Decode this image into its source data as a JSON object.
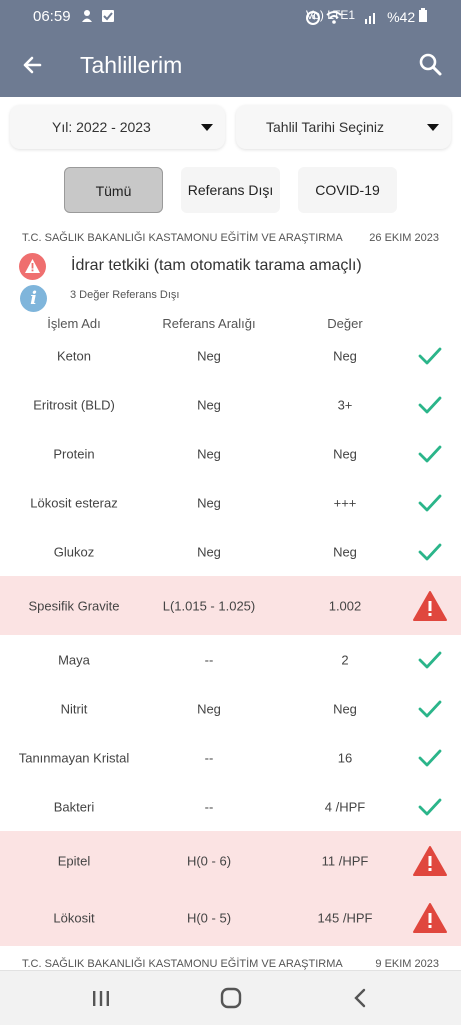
{
  "status_bar": {
    "time": "06:59",
    "network": "Vo) LTE1",
    "battery": "%42"
  },
  "app_bar": {
    "title": "Tahlillerim",
    "back_icon": "arrow-left-icon",
    "search_icon": "search-icon"
  },
  "filters": {
    "year": "Yıl: 2022 - 2023",
    "date": "Tahlil Tarihi Seçiniz"
  },
  "tabs": [
    {
      "label": "Tümü",
      "active": true
    },
    {
      "label": "Referans Dışı",
      "active": false
    },
    {
      "label": "COVID-19",
      "active": false
    }
  ],
  "record": {
    "institution": "T.C. SAĞLIK BAKANLIĞI KASTAMONU EĞİTİM VE ARAŞTIRMA",
    "date": "26 EKIM 2023",
    "test_name": "İdrar tetkiki (tam otomatik tarama amaçlı)",
    "out_of_range_text": "3 Değer Referans Dışı",
    "info_icon_letter": "i"
  },
  "table": {
    "headers": [
      "İşlem Adı",
      "Referans Aralığı",
      "Değer"
    ],
    "rows": [
      {
        "name": "Keton",
        "ref": "Neg",
        "value": "Neg",
        "status": "ok"
      },
      {
        "name": "Eritrosit (BLD)",
        "ref": "Neg",
        "value": "3+",
        "status": "ok"
      },
      {
        "name": "Protein",
        "ref": "Neg",
        "value": "Neg",
        "status": "ok"
      },
      {
        "name": "Lökosit esteraz",
        "ref": "Neg",
        "value": "+++",
        "status": "ok"
      },
      {
        "name": "Glukoz",
        "ref": "Neg",
        "value": "Neg",
        "status": "ok"
      },
      {
        "name": "Spesifik Gravite",
        "ref": "L(1.015 - 1.025)",
        "value": "1.002",
        "status": "alert"
      },
      {
        "name": "Maya",
        "ref": "--",
        "value": "2",
        "status": "ok"
      },
      {
        "name": "Nitrit",
        "ref": "Neg",
        "value": "Neg",
        "status": "ok"
      },
      {
        "name": "Tanınmayan Kristal",
        "ref": "--",
        "value": "16",
        "status": "ok"
      },
      {
        "name": "Bakteri",
        "ref": "--",
        "value": "4 /HPF",
        "status": "ok"
      },
      {
        "name": "Epitel",
        "ref": "H(0 - 6)",
        "value": "11 /HPF",
        "status": "alert"
      },
      {
        "name": "Lökosit",
        "ref": "H(0 - 5)",
        "value": "145 /HPF",
        "status": "alert"
      }
    ]
  },
  "next_record": {
    "institution": "T.C. SAĞLIK BAKANLIĞI KASTAMONU EĞİTİM VE ARAŞTIRMA",
    "date": "9 EKIM 2023"
  },
  "colors": {
    "app_bar": "#6e7b92",
    "ok_check": "#2bb58a",
    "alert_icon": "#e0473e",
    "alert_row": "#fbe3e3"
  }
}
